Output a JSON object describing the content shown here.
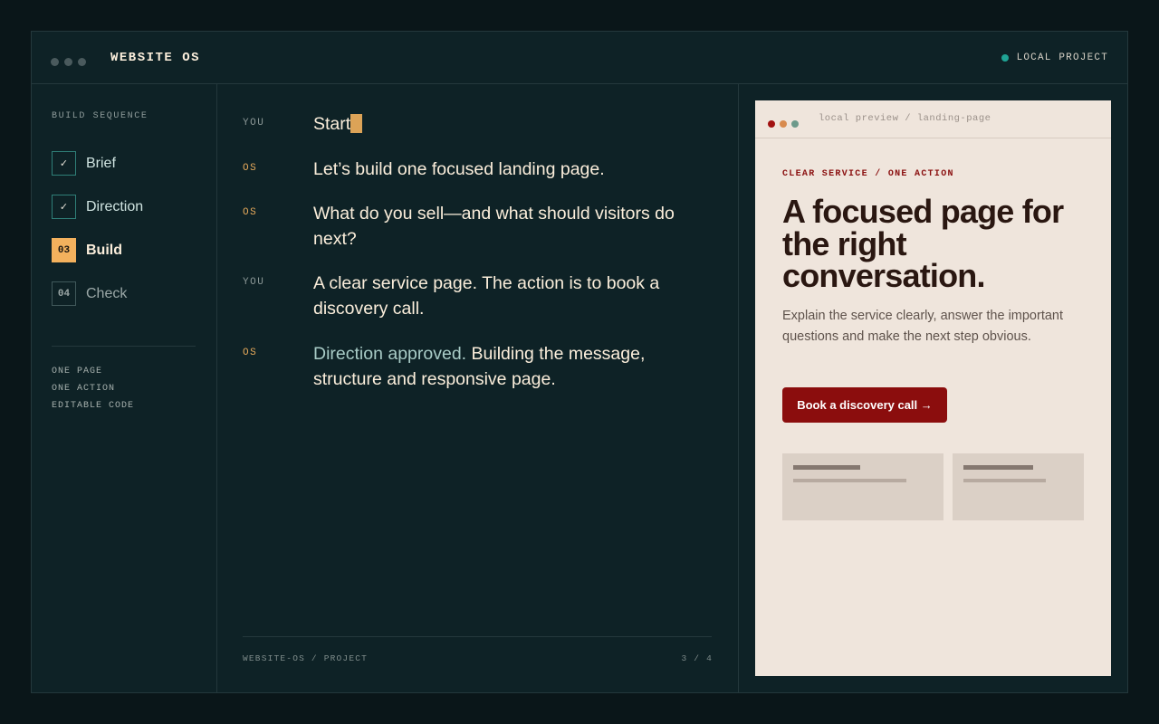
{
  "window": {
    "title": "WEBSITE OS",
    "project_status": "LOCAL PROJECT"
  },
  "colors": {
    "accent": "#f3b15d",
    "teal": "#1fa394",
    "brand_red": "#8b0d0d",
    "bg": "#0e2226"
  },
  "sidebar": {
    "heading": "BUILD SEQUENCE",
    "steps": [
      {
        "marker": "✓",
        "label": "Brief",
        "state": "done"
      },
      {
        "marker": "✓",
        "label": "Direction",
        "state": "done"
      },
      {
        "marker": "03",
        "label": "Build",
        "state": "active"
      },
      {
        "marker": "04",
        "label": "Check",
        "state": "todo"
      }
    ],
    "features": [
      "ONE PAGE",
      "ONE ACTION",
      "EDITABLE CODE"
    ]
  },
  "chat": {
    "messages": [
      {
        "role": "YOU",
        "text": "Start"
      },
      {
        "role": "OS",
        "text": "Let’s build one focused landing page."
      },
      {
        "role": "OS",
        "text": "What do you sell—and what should visitors do next?"
      },
      {
        "role": "YOU",
        "text": "A clear service page. The action is to book a discovery call."
      },
      {
        "role": "OS",
        "highlight": "Direction approved.",
        "text": " Building the message, structure and responsive page."
      }
    ],
    "footer_left": "WEBSITE-OS / PROJECT",
    "footer_right": "3 / 4"
  },
  "preview": {
    "url": "local preview / landing-page",
    "eyebrow": "CLEAR SERVICE / ONE ACTION",
    "headline": "A focused page for the right conversation.",
    "body": "Explain the service clearly, answer the important questions and make the next step obvious.",
    "cta": "Book a discovery call →"
  }
}
